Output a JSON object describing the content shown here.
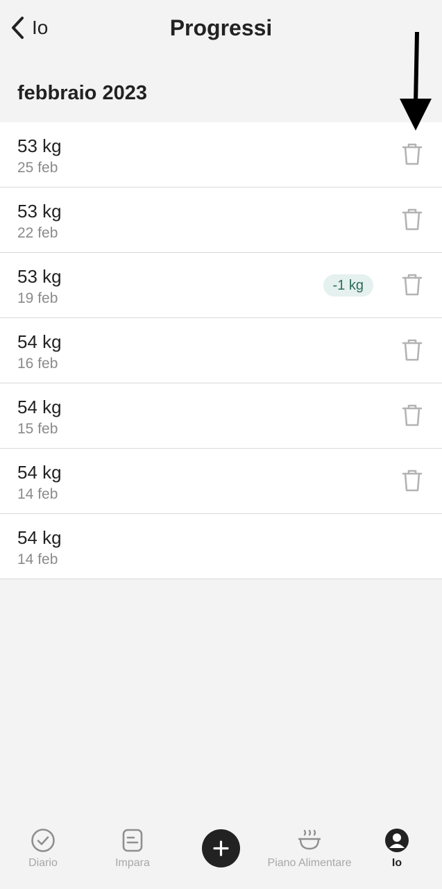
{
  "header": {
    "back_label": "Io",
    "title": "Progressi"
  },
  "section": {
    "title": "febbraio 2023"
  },
  "entries": [
    {
      "weight": "53 kg",
      "date": "25 feb",
      "badge": "",
      "deletable": true
    },
    {
      "weight": "53 kg",
      "date": "22 feb",
      "badge": "",
      "deletable": true
    },
    {
      "weight": "53 kg",
      "date": "19 feb",
      "badge": "-1 kg",
      "deletable": true
    },
    {
      "weight": "54 kg",
      "date": "16 feb",
      "badge": "",
      "deletable": true
    },
    {
      "weight": "54 kg",
      "date": "15 feb",
      "badge": "",
      "deletable": true
    },
    {
      "weight": "54 kg",
      "date": "14 feb",
      "badge": "",
      "deletable": true
    },
    {
      "weight": "54 kg",
      "date": "14 feb",
      "badge": "",
      "deletable": false
    }
  ],
  "tabbar": {
    "tabs": [
      {
        "label": "Diario",
        "icon": "check-circle-icon",
        "active": false
      },
      {
        "label": "Impara",
        "icon": "document-icon",
        "active": false
      },
      {
        "label": "Piano Alimentare",
        "icon": "bowl-icon",
        "active": false
      },
      {
        "label": "Io",
        "icon": "person-icon",
        "active": true
      }
    ],
    "fab_icon": "plus-icon"
  },
  "colors": {
    "background": "#f3f3f3",
    "badge_bg": "#e4f1ee",
    "badge_text": "#2f6b5b",
    "fab": "#222222"
  }
}
